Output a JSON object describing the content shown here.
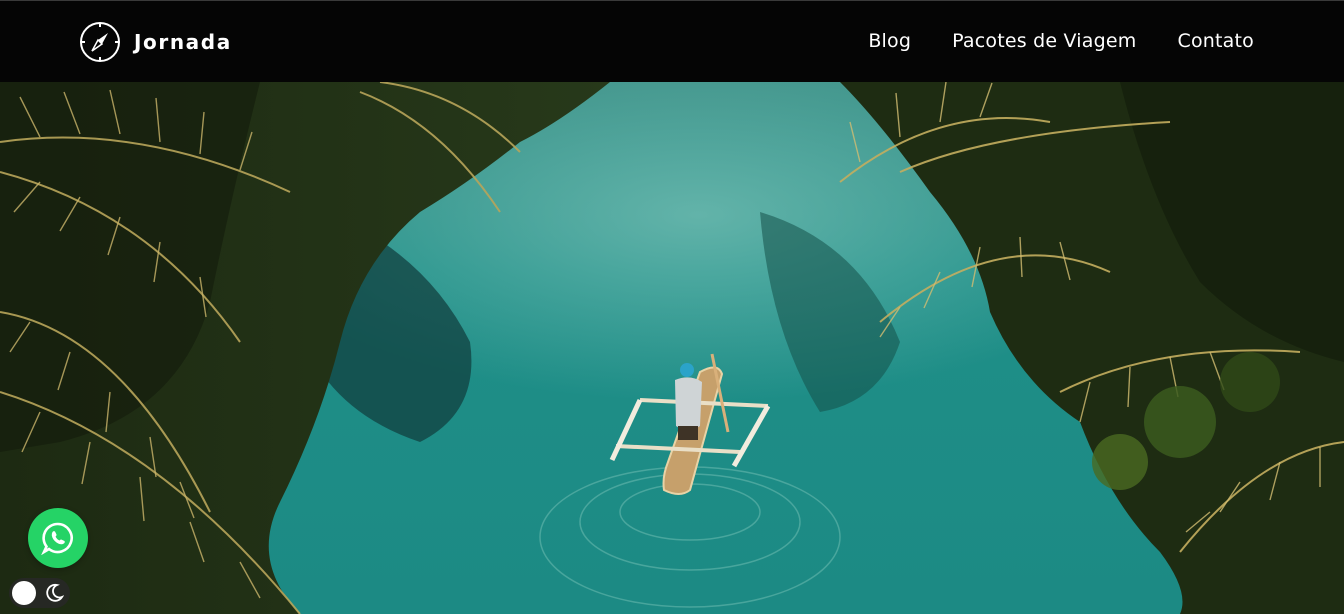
{
  "header": {
    "brand_name": "Jornada",
    "logo_icon": "compass-icon",
    "background": "#050505"
  },
  "nav": {
    "items": [
      {
        "label": "Blog"
      },
      {
        "label": "Pacotes de Viagem"
      },
      {
        "label": "Contato"
      }
    ]
  },
  "hero": {
    "image_subject": "aerial view of a person paddling an outrigger canoe on a turquoise river between palm trees",
    "water_color": "#1f8f88"
  },
  "floating": {
    "whatsapp_icon": "whatsapp-icon",
    "whatsapp_color": "#25d366",
    "theme_toggle_icon": "moon-icon"
  }
}
